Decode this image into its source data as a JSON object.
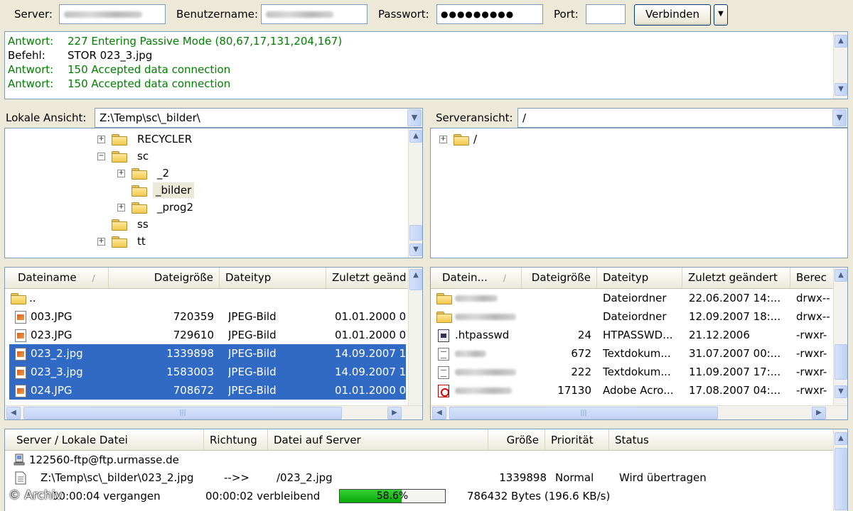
{
  "connect_bar": {
    "server_label": "Server:",
    "user_label": "Benutzername:",
    "password_label": "Passwort:",
    "password_value": "●●●●●●●●●",
    "port_label": "Port:",
    "port_value": "",
    "connect_button": "Verbinden",
    "dropdown_arrow": "▼"
  },
  "log": [
    {
      "key": "Antwort:",
      "text": "227 Entering Passive Mode (80,67,17,131,204,167)",
      "type": "response"
    },
    {
      "key": "Befehl:",
      "text": "STOR 023_3.jpg",
      "type": "command"
    },
    {
      "key": "Antwort:",
      "text": "150 Accepted data connection",
      "type": "response"
    },
    {
      "key": "Antwort:",
      "text": "150 Accepted data connection",
      "type": "response"
    }
  ],
  "local": {
    "label": "Lokale Ansicht:",
    "path": "Z:\\Temp\\sc\\_bilder\\",
    "tree": [
      {
        "name": "RECYCLER",
        "expander": "+"
      },
      {
        "name": "sc",
        "expander": "−"
      },
      {
        "name": "_2",
        "expander": "+"
      },
      {
        "name": "_bilder",
        "expander": ""
      },
      {
        "name": "_prog2",
        "expander": "+"
      },
      {
        "name": "ss",
        "expander": ""
      },
      {
        "name": "tt",
        "expander": "+"
      }
    ],
    "columns": {
      "name": "Dateiname",
      "size": "Dateigröße",
      "type": "Dateityp",
      "modified": "Zuletzt geänd",
      "sort_arrow": "/"
    },
    "parent_dir": "..",
    "files": [
      {
        "name": "003.JPG",
        "size": "720359",
        "type": "JPEG-Bild",
        "modified": "01.01.2000 0"
      },
      {
        "name": "023.JPG",
        "size": "729610",
        "type": "JPEG-Bild",
        "modified": "01.01.2000 0"
      },
      {
        "name": "023_2.jpg",
        "size": "1339898",
        "type": "JPEG-Bild",
        "modified": "14.09.2007 1"
      },
      {
        "name": "023_3.jpg",
        "size": "1583003",
        "type": "JPEG-Bild",
        "modified": "14.09.2007 1"
      },
      {
        "name": "024.JPG",
        "size": "708672",
        "type": "JPEG-Bild",
        "modified": "01.01.2000 0"
      }
    ]
  },
  "remote": {
    "label": "Serveransicht:",
    "path": "/",
    "tree_root": "/",
    "tree_expander": "+",
    "columns": {
      "name": "Datein...",
      "size": "Dateigröße",
      "type": "Dateityp",
      "modified": "Zuletzt geändert",
      "perm": "Berec",
      "sort_arrow": "/"
    },
    "files": [
      {
        "name": "",
        "size": "",
        "type": "Dateiordner",
        "modified": "22.06.2007 14:...",
        "perm": "drwx--",
        "icon": "folder"
      },
      {
        "name": "",
        "size": "",
        "type": "Dateiordner",
        "modified": "12.09.2007 18:...",
        "perm": "drwx--",
        "icon": "folder"
      },
      {
        "name": ".htpasswd",
        "size": "24",
        "type": "HTPASSWD...",
        "modified": "21.12.2006",
        "perm": "-rwxr-",
        "icon": "htpasswd"
      },
      {
        "name": "",
        "size": "672",
        "type": "Textdokum...",
        "modified": "31.07.2007 00:...",
        "perm": "-rwxr-",
        "icon": "text"
      },
      {
        "name": "",
        "size": "222",
        "type": "Textdokum...",
        "modified": "11.09.2007 17:...",
        "perm": "-rwxr-",
        "icon": "text"
      },
      {
        "name": "",
        "size": "17130",
        "type": "Adobe Acro...",
        "modified": "17.08.2007 04:...",
        "perm": "-rwxr-",
        "icon": "pdf"
      }
    ]
  },
  "queue": {
    "columns": {
      "local": "Server / Lokale Datei",
      "direction": "Richtung",
      "remote": "Datei auf Server",
      "size": "Größe",
      "priority": "Priorität",
      "status": "Status"
    },
    "server": "122560-ftp@ftp.urmasse.de",
    "transfer": {
      "local": "Z:\\Temp\\sc\\_bilder\\023_2.jpg",
      "direction": "-->>",
      "remote": "/023_2.jpg",
      "size": "1339898",
      "priority": "Normal",
      "status": "Wird übertragen",
      "elapsed": "00:00:04 vergangen",
      "remaining": "00:00:02 verbleibend",
      "progress_percent": 58.6,
      "progress_label": "58.6%",
      "bytes": "786432 Bytes (196.6 KB/s)"
    }
  },
  "watermark": "© Archiv",
  "scroll": {
    "up": "▲",
    "down": "▼",
    "left": "◀",
    "right": "▶",
    "grip": "|||"
  }
}
